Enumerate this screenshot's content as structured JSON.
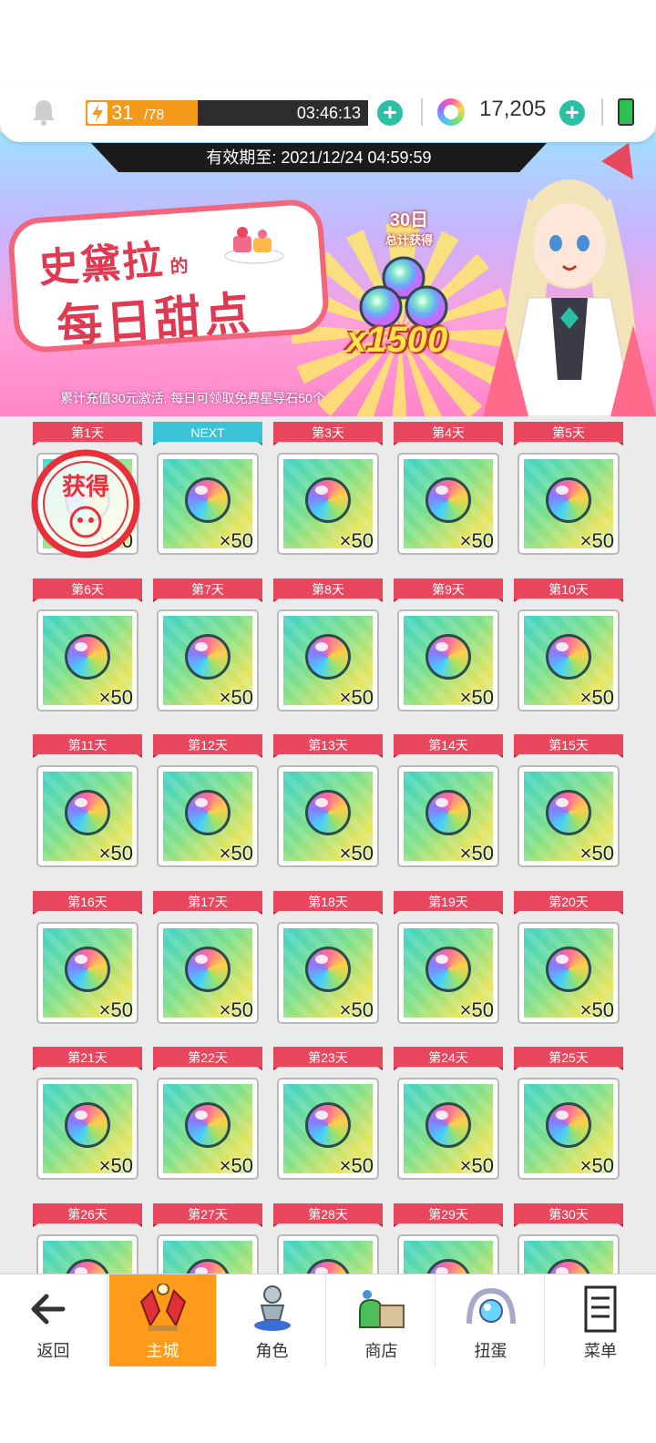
{
  "topbar": {
    "stamina_current": "31",
    "stamina_max": "/78",
    "stamina_fill_percent": 39.7,
    "stamina_timer": "03:46:13",
    "gem_count": "17,205"
  },
  "banner": {
    "expiry": "有效期至: 2021/12/24 04:59:59",
    "title_line1": "史黛拉",
    "title_of": "的",
    "title_line2": "每日甜点",
    "days_big": "30日",
    "days_small": "总计获得",
    "total_reward": "x1500",
    "footer": "累计充值30元激活, 每日可领取免费星导石50个"
  },
  "rewards": {
    "obtained_stamp": "获得",
    "days": [
      {
        "label": "第1天",
        "qty": "×50",
        "claimed": true
      },
      {
        "label": "NEXT",
        "qty": "×50",
        "next": true
      },
      {
        "label": "第3天",
        "qty": "×50"
      },
      {
        "label": "第4天",
        "qty": "×50"
      },
      {
        "label": "第5天",
        "qty": "×50"
      },
      {
        "label": "第6天",
        "qty": "×50"
      },
      {
        "label": "第7天",
        "qty": "×50"
      },
      {
        "label": "第8天",
        "qty": "×50"
      },
      {
        "label": "第9天",
        "qty": "×50"
      },
      {
        "label": "第10天",
        "qty": "×50"
      },
      {
        "label": "第11天",
        "qty": "×50"
      },
      {
        "label": "第12天",
        "qty": "×50"
      },
      {
        "label": "第13天",
        "qty": "×50"
      },
      {
        "label": "第14天",
        "qty": "×50"
      },
      {
        "label": "第15天",
        "qty": "×50"
      },
      {
        "label": "第16天",
        "qty": "×50"
      },
      {
        "label": "第17天",
        "qty": "×50"
      },
      {
        "label": "第18天",
        "qty": "×50"
      },
      {
        "label": "第19天",
        "qty": "×50"
      },
      {
        "label": "第20天",
        "qty": "×50"
      },
      {
        "label": "第21天",
        "qty": "×50"
      },
      {
        "label": "第22天",
        "qty": "×50"
      },
      {
        "label": "第23天",
        "qty": "×50"
      },
      {
        "label": "第24天",
        "qty": "×50"
      },
      {
        "label": "第25天",
        "qty": "×50"
      },
      {
        "label": "第26天",
        "qty": ""
      },
      {
        "label": "第27天",
        "qty": ""
      },
      {
        "label": "第28天",
        "qty": ""
      },
      {
        "label": "第29天",
        "qty": ""
      },
      {
        "label": "第30天",
        "qty": ""
      }
    ]
  },
  "nav": {
    "items": [
      {
        "label": "返回",
        "icon": "back-arrow-icon"
      },
      {
        "label": "主城",
        "icon": "crystal-city-icon",
        "active": true
      },
      {
        "label": "角色",
        "icon": "character-icon"
      },
      {
        "label": "商店",
        "icon": "shop-bags-icon"
      },
      {
        "label": "扭蛋",
        "icon": "gacha-icon"
      },
      {
        "label": "菜单",
        "icon": "menu-list-icon"
      }
    ]
  },
  "colors": {
    "accent_red": "#e8475e",
    "next_cyan": "#3ac3d6",
    "stamina_orange": "#f39a1a",
    "plus_teal": "#2bbfa6",
    "nav_active": "#ff9b1b"
  }
}
